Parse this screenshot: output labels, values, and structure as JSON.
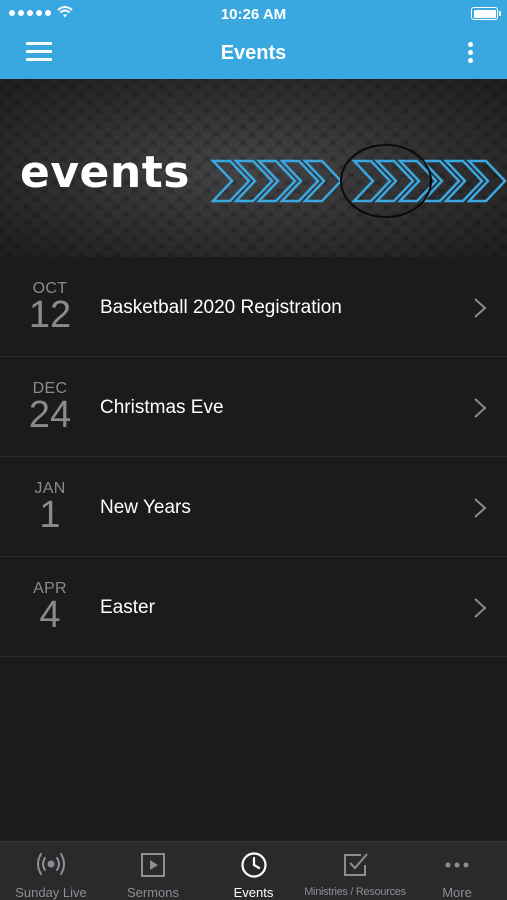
{
  "status_bar": {
    "time": "10:26 AM"
  },
  "nav": {
    "title": "Events",
    "menu_icon": "hamburger-icon",
    "more_icon": "vertical-dots-icon"
  },
  "banner": {
    "word": "events",
    "accent_color": "#3aa8e0"
  },
  "events": [
    {
      "month": "OCT",
      "day": "12",
      "title": "Basketball 2020 Registration"
    },
    {
      "month": "DEC",
      "day": "24",
      "title": "Christmas Eve"
    },
    {
      "month": "JAN",
      "day": "1",
      "title": "New Years"
    },
    {
      "month": "APR",
      "day": "4",
      "title": "Easter"
    }
  ],
  "tabs": [
    {
      "label": "Sunday Live",
      "icon": "broadcast-icon",
      "active": false
    },
    {
      "label": "Sermons",
      "icon": "play-icon",
      "active": false
    },
    {
      "label": "Events",
      "icon": "clock-icon",
      "active": true
    },
    {
      "label": "Ministries / Resources",
      "icon": "checkbox-icon",
      "active": false
    },
    {
      "label": "More",
      "icon": "more-dots-icon",
      "active": false
    }
  ],
  "colors": {
    "header": "#3aa8e0",
    "background": "#1b1b1d",
    "tabbar": "#2a2a2d"
  }
}
